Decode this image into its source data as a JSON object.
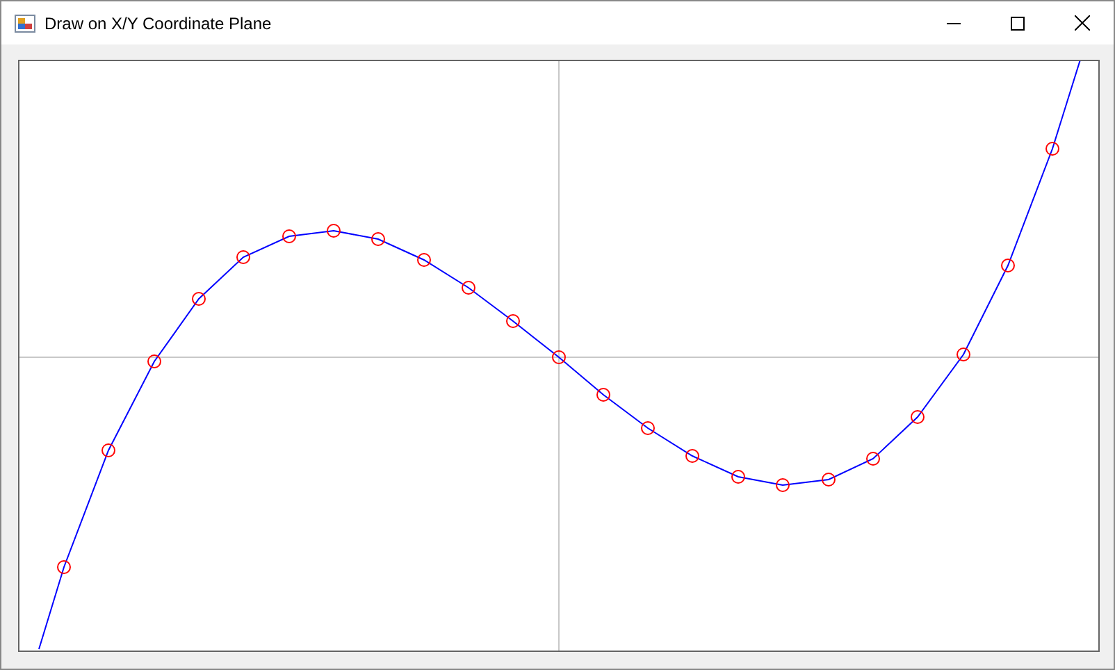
{
  "window": {
    "title": "Draw on X/Y Coordinate Plane"
  }
}
